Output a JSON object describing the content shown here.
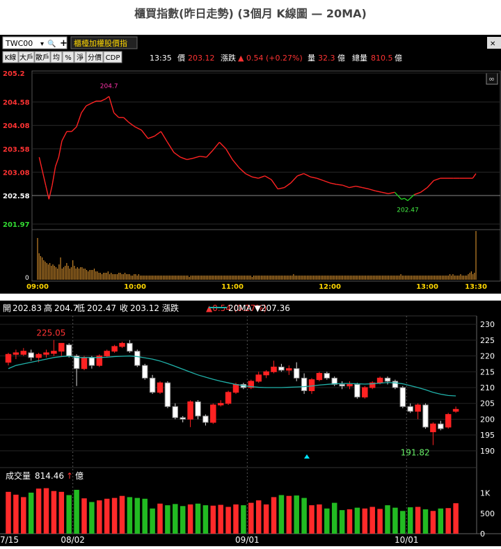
{
  "page": {
    "title": "櫃買指數(昨日走勢) (3個月 K線圖 — 20MA)"
  },
  "toolbar": {
    "symbol": "TWC00",
    "dropdown_glyph": "▾",
    "search_glyph": "🔍",
    "add_glyph": "+",
    "index_name": "櫃檯加權股價指",
    "tabs": [
      "K線",
      "大戶",
      "散戶",
      "均",
      "%",
      "淨",
      "分價",
      "CDP"
    ],
    "close_glyph": "✕"
  },
  "quote": {
    "time": "13:35",
    "price_label": "價",
    "price": "203.12",
    "change_label": "漲跌",
    "change_arrow": "▲",
    "change": "0.54 (+0.27%)",
    "volume_label": "量",
    "volume": "32.3",
    "volume_unit": "億",
    "total_label": "總量",
    "total": "810.5",
    "total_unit": "億"
  },
  "k_header": {
    "open_label": "開",
    "open": "202.83",
    "high_label": "高",
    "high": "204.7",
    "low_label": "低",
    "low": "202.47",
    "close_label": "收",
    "close": "203.12",
    "change_label": "漲跌",
    "change": "▲0.54 (0.27%)",
    "ma_label": "20MA ▼207.36",
    "vol_label": "成交量",
    "vol_value": "814.46",
    "vol_arrow": "↑",
    "vol_unit": "億"
  },
  "colors": {
    "up": "#ff2a2a",
    "down": "#22bb22",
    "ma": "#20b2aa",
    "bar": "#c8862a",
    "high_label": "#ff33aa",
    "low_label": "#44ee44"
  },
  "chart_data": [
    {
      "type": "line",
      "title": "",
      "ylim": [
        201.97,
        205.2
      ],
      "ytick_labels": [
        "205.2",
        "204.58",
        "204.08",
        "203.58",
        "203.08",
        "202.58",
        "201.97"
      ],
      "ytick_values": [
        205.2,
        204.58,
        204.08,
        203.58,
        203.08,
        202.58,
        201.97
      ],
      "reference_close": 202.58,
      "x_labels": [
        "09:00",
        "10:00",
        "11:00",
        "12:00",
        "13:00",
        "13:30"
      ],
      "x_minutes": [
        0,
        60,
        120,
        180,
        240,
        270
      ],
      "annotations": [
        {
          "label": "204.7",
          "minute": 44,
          "value": 204.7
        },
        {
          "label": "202.47",
          "minute": 228,
          "value": 202.47
        }
      ],
      "series": [
        {
          "values_minute": [
            1,
            3,
            5,
            7,
            9,
            11,
            13,
            15,
            18,
            21,
            24,
            27,
            30,
            33,
            36,
            39,
            42,
            44,
            47,
            50,
            53,
            56,
            60,
            64,
            68,
            72,
            76,
            80,
            84,
            88,
            92,
            96,
            100,
            104,
            108,
            112,
            116,
            120,
            124,
            128,
            132,
            136,
            140,
            144,
            148,
            152,
            156,
            160,
            164,
            168,
            172,
            176,
            180,
            184,
            188,
            192,
            196,
            200,
            204,
            208,
            212,
            216,
            220,
            224,
            226,
            228,
            232,
            236,
            240,
            244,
            248,
            252,
            256,
            260,
            264,
            268,
            270
          ],
          "values": [
            203.4,
            203.1,
            202.8,
            202.5,
            202.8,
            203.2,
            203.4,
            203.75,
            203.95,
            203.95,
            204.05,
            204.35,
            204.5,
            204.55,
            204.6,
            204.6,
            204.65,
            204.7,
            204.35,
            204.25,
            204.25,
            204.15,
            204.05,
            203.98,
            203.8,
            203.85,
            203.95,
            203.72,
            203.5,
            203.4,
            203.35,
            203.38,
            203.42,
            203.4,
            203.55,
            203.72,
            203.58,
            203.35,
            203.18,
            203.05,
            202.98,
            202.95,
            203.0,
            202.92,
            202.72,
            202.75,
            202.85,
            203.0,
            203.05,
            202.98,
            202.95,
            202.9,
            202.85,
            202.82,
            202.8,
            202.75,
            202.78,
            202.75,
            202.72,
            202.68,
            202.65,
            202.62,
            202.65,
            202.5,
            202.52,
            202.47,
            202.6,
            202.65,
            202.75,
            202.9,
            202.95,
            202.95,
            202.95,
            202.95,
            202.95,
            202.95,
            203.05
          ]
        }
      ],
      "volume": {
        "ylabel": "0",
        "bars": [
          30,
          19,
          17,
          16,
          14,
          13,
          12,
          11,
          12,
          10,
          11,
          10,
          9,
          8,
          11,
          16,
          8,
          9,
          10,
          12,
          10,
          8,
          9,
          14,
          10,
          8,
          9,
          8,
          9,
          9,
          8,
          8,
          7,
          6,
          7,
          7,
          7,
          8,
          6,
          6,
          5,
          5,
          4,
          5,
          5,
          5,
          6,
          4,
          5,
          4,
          4,
          4,
          4,
          5,
          5,
          4,
          4,
          5,
          4,
          4,
          4,
          3,
          3,
          4,
          4,
          3,
          4,
          3,
          3,
          3,
          3,
          3,
          3,
          3,
          3,
          3,
          3,
          3,
          3,
          3,
          3,
          3,
          3,
          3,
          3,
          3,
          3,
          3,
          3,
          3,
          3,
          3,
          3,
          3,
          3,
          3,
          3,
          3,
          3,
          2,
          3,
          3,
          3,
          3,
          3,
          3,
          3,
          3,
          3,
          3,
          3,
          3,
          3,
          3,
          3,
          3,
          3,
          3,
          3,
          3,
          3,
          3,
          3,
          3,
          3,
          3,
          3,
          3,
          3,
          3,
          3,
          3,
          3,
          3,
          3,
          3,
          3,
          3,
          3,
          3,
          2,
          3,
          3,
          3,
          3,
          3,
          3,
          3,
          3,
          3,
          3,
          3,
          3,
          3,
          3,
          3,
          3,
          3,
          3,
          3,
          3,
          3,
          3,
          3,
          3,
          3,
          3,
          4,
          3,
          3,
          3,
          3,
          3,
          3,
          3,
          3,
          3,
          3,
          3,
          3,
          3,
          3,
          3,
          3,
          3,
          3,
          3,
          3,
          3,
          3,
          3,
          3,
          3,
          3,
          3,
          3,
          3,
          3,
          3,
          3,
          3,
          3,
          3,
          3,
          3,
          3,
          3,
          3,
          3,
          3,
          3,
          3,
          3,
          3,
          3,
          3,
          3,
          3,
          3,
          3,
          3,
          3,
          3,
          3,
          3,
          3,
          3,
          3,
          3,
          3,
          3,
          3,
          3,
          3,
          3,
          3,
          3,
          4,
          3,
          3,
          3,
          3,
          3,
          3,
          3,
          3,
          3,
          3,
          3,
          3,
          3,
          3,
          3,
          3,
          3,
          3,
          3,
          3,
          3,
          3,
          3,
          3,
          3,
          3,
          3,
          3,
          3,
          3,
          3,
          4,
          3,
          4,
          3,
          3,
          3,
          3,
          4,
          3,
          3,
          3,
          3,
          4,
          5,
          6,
          4,
          5,
          35
        ]
      }
    },
    {
      "type": "candlestick",
      "title": "",
      "ylim": [
        188,
        232
      ],
      "yticks": [
        190,
        195,
        200,
        205,
        210,
        215,
        220,
        225,
        230
      ],
      "x_labels": [
        "7/15",
        "08/02",
        "09/01",
        "10/01"
      ],
      "x_label_index": [
        0,
        9,
        32,
        53
      ],
      "annotations": [
        {
          "label": "225.05",
          "index": 6,
          "value": 225.05
        },
        {
          "label": "191.82",
          "index": 54,
          "value": 191.82
        }
      ],
      "candles": [
        {
          "o": 218,
          "h": 221,
          "l": 217,
          "c": 220.5
        },
        {
          "o": 220.5,
          "h": 222,
          "l": 219,
          "c": 221
        },
        {
          "o": 220.5,
          "h": 222.5,
          "l": 220,
          "c": 221.5
        },
        {
          "o": 221,
          "h": 222,
          "l": 218.5,
          "c": 219.5
        },
        {
          "o": 219.5,
          "h": 221,
          "l": 218,
          "c": 220.5
        },
        {
          "o": 220.5,
          "h": 222,
          "l": 219.5,
          "c": 221
        },
        {
          "o": 220.8,
          "h": 225.05,
          "l": 220,
          "c": 221.5
        },
        {
          "o": 221.5,
          "h": 224,
          "l": 220,
          "c": 224
        },
        {
          "o": 223.5,
          "h": 224,
          "l": 219.5,
          "c": 220
        },
        {
          "o": 220,
          "h": 220.5,
          "l": 210.5,
          "c": 216
        },
        {
          "o": 216,
          "h": 220,
          "l": 215.5,
          "c": 219.5
        },
        {
          "o": 219.5,
          "h": 220,
          "l": 216,
          "c": 217
        },
        {
          "o": 217,
          "h": 220.5,
          "l": 216.5,
          "c": 220
        },
        {
          "o": 220,
          "h": 222,
          "l": 219.5,
          "c": 221.5
        },
        {
          "o": 221.5,
          "h": 223.5,
          "l": 221,
          "c": 223
        },
        {
          "o": 223,
          "h": 224.5,
          "l": 222.5,
          "c": 224
        },
        {
          "o": 224,
          "h": 225,
          "l": 221,
          "c": 221.5
        },
        {
          "o": 221.5,
          "h": 222,
          "l": 216.5,
          "c": 217
        },
        {
          "o": 217,
          "h": 217.5,
          "l": 212.5,
          "c": 213
        },
        {
          "o": 213,
          "h": 214,
          "l": 208,
          "c": 208.5
        },
        {
          "o": 208.5,
          "h": 212,
          "l": 208,
          "c": 211.5
        },
        {
          "o": 211.5,
          "h": 212,
          "l": 203.5,
          "c": 204
        },
        {
          "o": 204,
          "h": 205,
          "l": 200,
          "c": 200.5
        },
        {
          "o": 200.5,
          "h": 201,
          "l": 199,
          "c": 200
        },
        {
          "o": 200,
          "h": 206,
          "l": 197.5,
          "c": 205.5
        },
        {
          "o": 205.5,
          "h": 206,
          "l": 200,
          "c": 201
        },
        {
          "o": 201,
          "h": 201.5,
          "l": 198,
          "c": 199
        },
        {
          "o": 199,
          "h": 205,
          "l": 198.5,
          "c": 204.5
        },
        {
          "o": 204.5,
          "h": 206,
          "l": 204,
          "c": 205
        },
        {
          "o": 205,
          "h": 209,
          "l": 204.5,
          "c": 208.5
        },
        {
          "o": 208.5,
          "h": 211.5,
          "l": 208,
          "c": 211
        },
        {
          "o": 211,
          "h": 211.5,
          "l": 209.5,
          "c": 210
        },
        {
          "o": 210,
          "h": 212.5,
          "l": 209.5,
          "c": 212
        },
        {
          "o": 212,
          "h": 215,
          "l": 211.5,
          "c": 214
        },
        {
          "o": 214,
          "h": 215.5,
          "l": 213,
          "c": 215
        },
        {
          "o": 215,
          "h": 218.5,
          "l": 214.5,
          "c": 216.5
        },
        {
          "o": 216.5,
          "h": 217.5,
          "l": 215,
          "c": 215.5
        },
        {
          "o": 215.5,
          "h": 217,
          "l": 214,
          "c": 216
        },
        {
          "o": 216,
          "h": 218,
          "l": 212,
          "c": 213
        },
        {
          "o": 213,
          "h": 214.5,
          "l": 208,
          "c": 209
        },
        {
          "o": 209,
          "h": 213,
          "l": 208,
          "c": 212.5
        },
        {
          "o": 212.5,
          "h": 215,
          "l": 212,
          "c": 214.5
        },
        {
          "o": 214.5,
          "h": 215,
          "l": 212.5,
          "c": 213
        },
        {
          "o": 213,
          "h": 213.5,
          "l": 210.5,
          "c": 211
        },
        {
          "o": 211,
          "h": 212,
          "l": 209.5,
          "c": 210.5
        },
        {
          "o": 210.5,
          "h": 212,
          "l": 209.5,
          "c": 211
        },
        {
          "o": 211,
          "h": 211.5,
          "l": 206.5,
          "c": 207
        },
        {
          "o": 207,
          "h": 210.5,
          "l": 206.5,
          "c": 210
        },
        {
          "o": 210,
          "h": 212,
          "l": 209.5,
          "c": 211.5
        },
        {
          "o": 211.5,
          "h": 213.5,
          "l": 211,
          "c": 213
        },
        {
          "o": 213,
          "h": 213.5,
          "l": 211,
          "c": 212
        },
        {
          "o": 212,
          "h": 212.5,
          "l": 209.5,
          "c": 210
        },
        {
          "o": 210,
          "h": 210.5,
          "l": 203.5,
          "c": 204
        },
        {
          "o": 204,
          "h": 205,
          "l": 202,
          "c": 202.5
        },
        {
          "o": 202.5,
          "h": 205,
          "l": 200,
          "c": 204.5
        },
        {
          "o": 204.5,
          "h": 205,
          "l": 197,
          "c": 197.5
        },
        {
          "o": 196,
          "h": 199,
          "l": 191.82,
          "c": 198.5
        },
        {
          "o": 198.5,
          "h": 199.5,
          "l": 196.5,
          "c": 197
        },
        {
          "o": 197.5,
          "h": 202,
          "l": 197,
          "c": 201.5
        },
        {
          "o": 202.5,
          "h": 204,
          "l": 202,
          "c": 203.12
        }
      ],
      "ma20": [
        216,
        217,
        217.5,
        218,
        218.5,
        219,
        219.5,
        219.8,
        220,
        219.5,
        219.5,
        219.5,
        219.5,
        219.6,
        219.8,
        219.9,
        220,
        219.8,
        219.4,
        219,
        218.4,
        217.6,
        216.7,
        215.8,
        214.9,
        214,
        213.3,
        212.6,
        212,
        211.5,
        211,
        210.6,
        210.3,
        210.1,
        210,
        210,
        210,
        210.1,
        210.2,
        210.3,
        210.5,
        210.8,
        211,
        211.2,
        211.3,
        211.3,
        211.2,
        211.1,
        211.2,
        211.4,
        211.6,
        211.5,
        211.2,
        210.6,
        210,
        209.3,
        208.5,
        207.9,
        207.5,
        207.36
      ],
      "volume": {
        "ylim": [
          0,
          1250
        ],
        "yticks": [
          0,
          500,
          1000
        ],
        "ytick_labels": [
          "0",
          "500",
          "1K"
        ],
        "values": [
          1030,
          960,
          900,
          1010,
          1110,
          1120,
          1050,
          1030,
          950,
          1080,
          870,
          780,
          820,
          860,
          880,
          930,
          900,
          880,
          860,
          620,
          740,
          700,
          730,
          680,
          720,
          740,
          700,
          690,
          710,
          660,
          720,
          700,
          760,
          820,
          720,
          900,
          950,
          930,
          940,
          880,
          700,
          720,
          620,
          760,
          580,
          600,
          640,
          620,
          660,
          610,
          700,
          640,
          560,
          650,
          660,
          600,
          560,
          620,
          630,
          750
        ],
        "up_flags": [
          true,
          true,
          true,
          false,
          true,
          true,
          true,
          true,
          false,
          false,
          true,
          false,
          true,
          true,
          true,
          true,
          false,
          false,
          false,
          false,
          true,
          false,
          false,
          false,
          true,
          false,
          false,
          true,
          true,
          true,
          true,
          false,
          true,
          true,
          true,
          true,
          false,
          true,
          false,
          false,
          true,
          true,
          false,
          false,
          false,
          true,
          false,
          true,
          true,
          true,
          false,
          false,
          false,
          false,
          true,
          false,
          true,
          false,
          true,
          true
        ]
      }
    }
  ]
}
